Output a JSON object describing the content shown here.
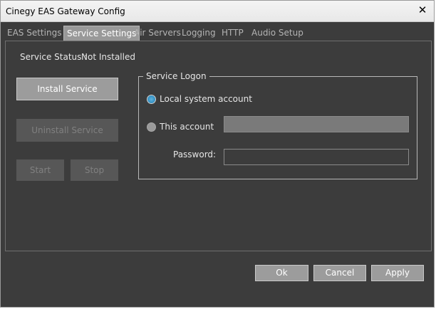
{
  "window": {
    "title": "Cinegy EAS Gateway Config",
    "close_glyph": "✕"
  },
  "tabs": [
    {
      "label": "EAS Settings",
      "active": false
    },
    {
      "label": "Service Settings",
      "active": true
    },
    {
      "label": "Air Servers",
      "active": false
    },
    {
      "label": "Logging",
      "active": false
    },
    {
      "label": "HTTP",
      "active": false
    },
    {
      "label": "Audio Setup",
      "active": false
    }
  ],
  "service": {
    "status_label": "Service Status :",
    "status_value": "Not Installed",
    "install_label": "Install Service",
    "uninstall_label": "Uninstall Service",
    "start_label": "Start",
    "stop_label": "Stop"
  },
  "logon": {
    "legend": "Service Logon",
    "local_label": "Local system account",
    "local_checked": true,
    "this_label": "This account",
    "this_checked": false,
    "account_value": "",
    "password_label": "Password:",
    "password_value": ""
  },
  "footer": {
    "ok_label": "Ok",
    "cancel_label": "Cancel",
    "apply_label": "Apply"
  },
  "colors": {
    "background": "#3c3c3c",
    "button": "#9c9c9c",
    "radio_checked": "#3a95c6"
  }
}
